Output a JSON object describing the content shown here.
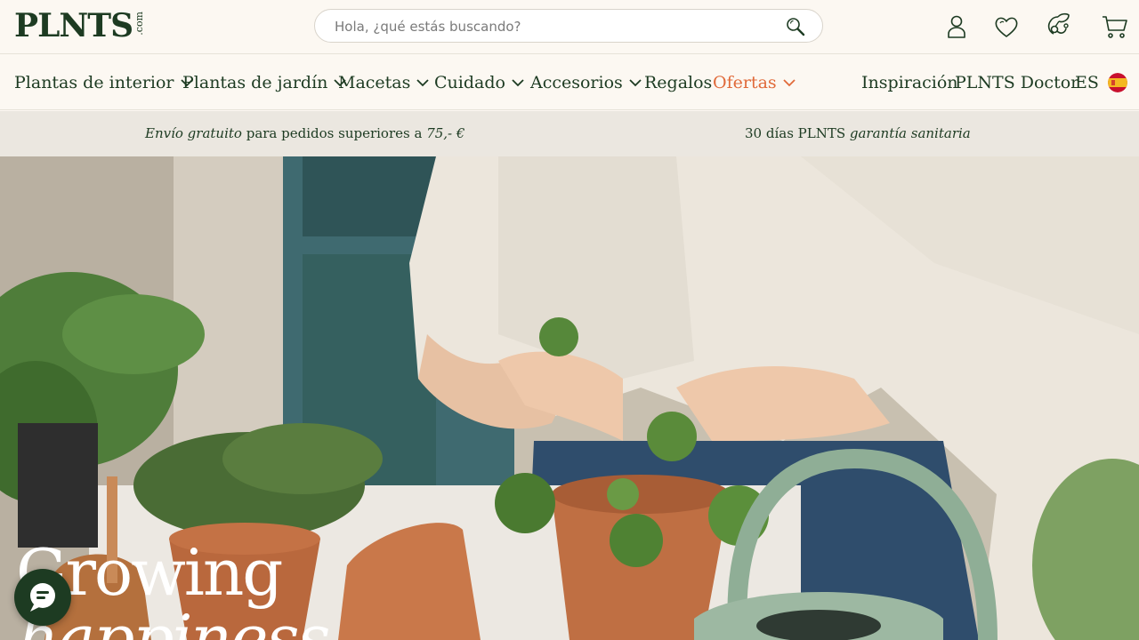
{
  "logo": {
    "main": "PLNTS",
    "suffix": ".com"
  },
  "search": {
    "placeholder": "Hola, ¿qué estás buscando?"
  },
  "header_icons": [
    "account-icon",
    "heart-icon",
    "plant-doctor-icon",
    "cart-icon"
  ],
  "nav": {
    "items": [
      {
        "label": "Plantas de interior"
      },
      {
        "label": "Plantas de jardín"
      },
      {
        "label": "Macetas"
      },
      {
        "label": "Cuidado"
      },
      {
        "label": "Accesorios"
      },
      {
        "label": "Regalos"
      },
      {
        "label": "Ofertas"
      }
    ],
    "right": [
      {
        "label": "Inspiración"
      },
      {
        "label": "PLNTS Doctor"
      },
      {
        "label": "ES"
      }
    ]
  },
  "promo": {
    "shipping_em": "Envío gratuito",
    "shipping_rest": " para pedidos superiores a ",
    "shipping_amount": "75,- €",
    "guarantee_pre": "30 días PLNTS ",
    "guarantee_em": "garantía sanitaria"
  },
  "hero": {
    "title_line1": "Growing",
    "title_line2": "happiness"
  },
  "colors": {
    "brand_green": "#1d3b22",
    "offer_orange": "#e06a3a",
    "background": "#fcf8f2",
    "promo_bg": "#ebe7e0"
  }
}
